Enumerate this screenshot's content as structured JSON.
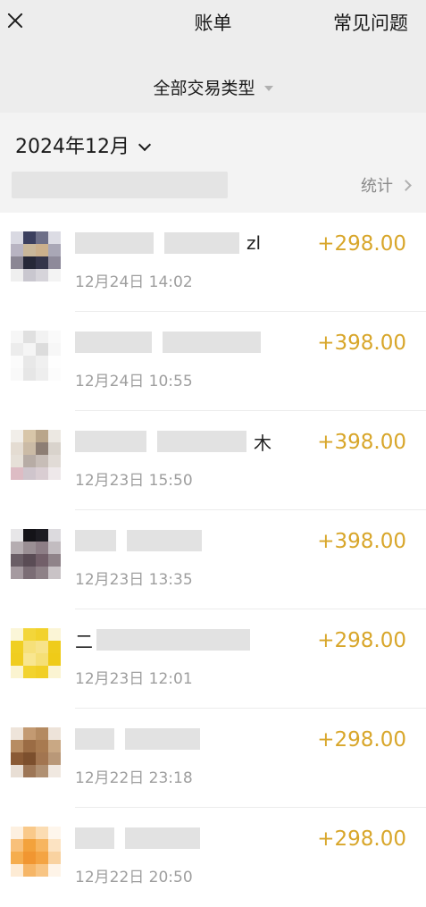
{
  "header": {
    "title": "账单",
    "right_link": "常见问题",
    "close_icon": "close-icon"
  },
  "filter": {
    "label": "全部交易类型",
    "caret_icon": "caret-down-icon"
  },
  "month_bar": {
    "month": "2024年12月",
    "stats_label": "统计"
  },
  "colors": {
    "amount": "#d8a62a",
    "header_bg": "#ededed",
    "secondary_text": "#9e9e9e"
  },
  "transactions": [
    {
      "name_suffix": "zl",
      "name_prefix": "",
      "time": "12月24日 14:02",
      "amount": "+298.00"
    },
    {
      "name_suffix": "",
      "name_prefix": "",
      "time": "12月24日 10:55",
      "amount": "+398.00"
    },
    {
      "name_suffix": "木",
      "name_prefix": "",
      "time": "12月23日 15:50",
      "amount": "+398.00"
    },
    {
      "name_suffix": "",
      "name_prefix": "",
      "time": "12月23日 13:35",
      "amount": "+398.00"
    },
    {
      "name_suffix": "",
      "name_prefix": "二",
      "time": "12月23日 12:01",
      "amount": "+298.00"
    },
    {
      "name_suffix": "",
      "name_prefix": "",
      "time": "12月22日 23:18",
      "amount": "+298.00"
    },
    {
      "name_suffix": "",
      "name_prefix": "",
      "time": "12月22日 20:50",
      "amount": "+298.00"
    }
  ]
}
